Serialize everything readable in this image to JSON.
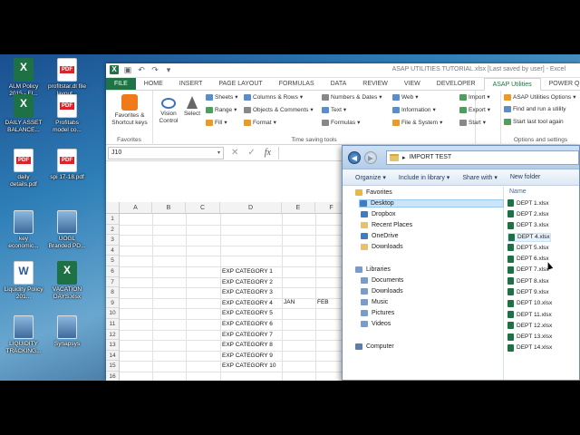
{
  "desktop": {
    "icons": [
      {
        "label": "ALM Policy 2015 - FI...",
        "type": "xl"
      },
      {
        "label": "profitstar.dl file layout...",
        "type": "pdf"
      },
      {
        "label": "DAILY ASSET BALANCE...",
        "type": "xl"
      },
      {
        "label": "Profitabs model co...",
        "type": "pdf"
      },
      {
        "label": "daily details.pdf",
        "type": "pdf"
      },
      {
        "label": "spi 17-18.pdf",
        "type": "pdf"
      },
      {
        "label": "key economic...",
        "type": "img"
      },
      {
        "label": "UOGL Branded PD...",
        "type": "img"
      },
      {
        "label": "Liquidity Policy 201...",
        "type": "doc"
      },
      {
        "label": "VACATION DAYS.xlsx",
        "type": "xl"
      },
      {
        "label": "LIQUIDITY TRACKING...",
        "type": "img"
      },
      {
        "label": "Synapsys",
        "type": "img"
      }
    ]
  },
  "excel": {
    "window_title": "ASAP UTILITIES TUTORIAL.xlsx [Last saved by user] - Excel",
    "tabs": [
      "FILE",
      "HOME",
      "INSERT",
      "PAGE LAYOUT",
      "FORMULAS",
      "DATA",
      "REVIEW",
      "VIEW",
      "DEVELOPER",
      "ASAP Utilities",
      "POWER QUERY"
    ],
    "ribbon": {
      "favorites_label": "Favorites & Shortcut keys",
      "favorites_group": "Favorites",
      "vision_control": "Vision Control",
      "select": "Select",
      "sheets": "Sheets",
      "range": "Range",
      "fill": "Fill",
      "columns_rows": "Columns & Rows",
      "objects_comments": "Objects & Comments",
      "format": "Format",
      "numbers_dates": "Numbers & Dates",
      "text": "Text",
      "formulas": "Formulas",
      "web": "Web",
      "information": "Information",
      "file_system": "File & System",
      "time_saving_group": "Time saving tools",
      "import": "Import",
      "export": "Export",
      "start": "Start",
      "asap_options": "ASAP Utilities Options",
      "find_run": "Find and run a utility",
      "start_last": "Start last tool again",
      "options_group": "Options and settings"
    },
    "name_box": "J10",
    "columns": [
      "A",
      "B",
      "C",
      "D",
      "E",
      "F"
    ],
    "rows": [
      "1",
      "2",
      "3",
      "4",
      "5",
      "6",
      "7",
      "8",
      "9",
      "10",
      "11",
      "12",
      "13",
      "14",
      "15",
      "16",
      "17"
    ],
    "month_headers": {
      "e5": "JAN",
      "f5": "FEB"
    },
    "categories": [
      "EXP CATEGORY 1",
      "EXP CATEGORY 2",
      "EXP CATEGORY 3",
      "EXP CATEGORY 4",
      "EXP CATEGORY 5",
      "EXP CATEGORY 6",
      "EXP CATEGORY 7",
      "EXP CATEGORY 8",
      "EXP CATEGORY 9",
      "EXP CATEGORY 10"
    ]
  },
  "explorer": {
    "path": "IMPORT TEST",
    "toolbar": {
      "organize": "Organize",
      "include": "Include in library",
      "share": "Share with",
      "new_folder": "New folder"
    },
    "nav": {
      "favorites": "Favorites",
      "desktop": "Desktop",
      "dropbox": "Dropbox",
      "recent": "Recent Places",
      "onedrive": "OneDrive",
      "downloads": "Downloads",
      "libraries": "Libraries",
      "documents": "Documents",
      "lib_downloads": "Downloads",
      "music": "Music",
      "pictures": "Pictures",
      "videos": "Videos",
      "computer": "Computer"
    },
    "column_name": "Name",
    "files": [
      "DEPT 1.xlsx",
      "DEPT 2.xlsx",
      "DEPT 3.xlsx",
      "DEPT 4.xlsx",
      "DEPT 5.xlsx",
      "DEPT 6.xlsx",
      "DEPT 7.xlsx",
      "DEPT 8.xlsx",
      "DEPT 9.xlsx",
      "DEPT 10.xlsx",
      "DEPT 11.xlsx",
      "DEPT 12.xlsx",
      "DEPT 13.xlsx",
      "DEPT 14.xlsx"
    ]
  }
}
